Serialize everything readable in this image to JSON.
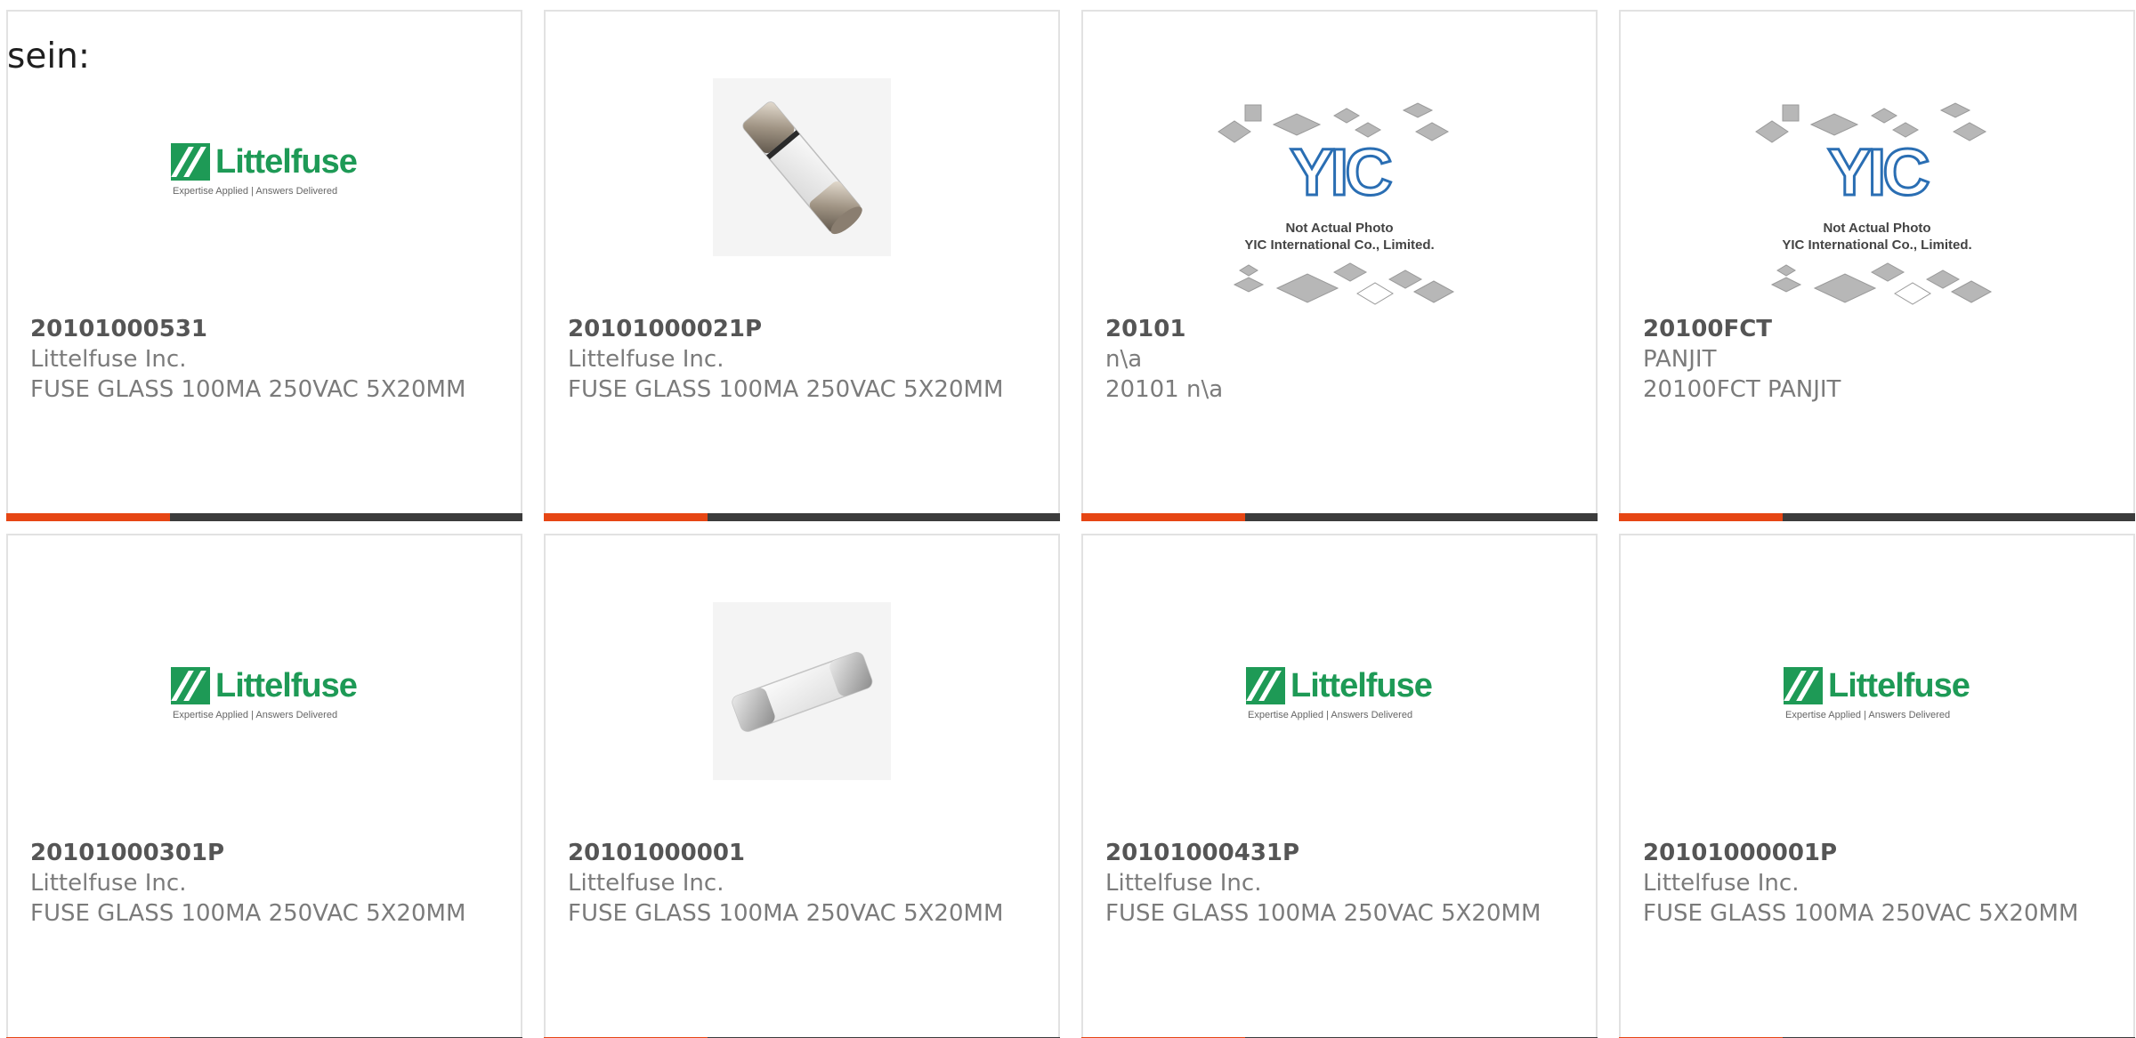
{
  "page": {
    "top_label": "sein:"
  },
  "products": [
    {
      "part_number": "20101000531",
      "manufacturer": "Littelfuse Inc.",
      "description": "FUSE GLASS 100MA 250VAC 5X20MM",
      "image": "littelfuse-logo"
    },
    {
      "part_number": "20101000021P",
      "manufacturer": "Littelfuse Inc.",
      "description": "FUSE GLASS 100MA 250VAC 5X20MM",
      "image": "fuse-photo-metal-caps"
    },
    {
      "part_number": "20101",
      "manufacturer": "n\\a",
      "description": "20101 n\\a",
      "image": "yic-placeholder"
    },
    {
      "part_number": "20100FCT",
      "manufacturer": "PANJIT",
      "description": "20100FCT PANJIT",
      "image": "yic-placeholder"
    },
    {
      "part_number": "20101000301P",
      "manufacturer": "Littelfuse Inc.",
      "description": "FUSE GLASS 100MA 250VAC 5X20MM",
      "image": "littelfuse-logo"
    },
    {
      "part_number": "20101000001",
      "manufacturer": "Littelfuse Inc.",
      "description": "FUSE GLASS 100MA 250VAC 5X20MM",
      "image": "fuse-photo-silver-caps"
    },
    {
      "part_number": "20101000431P",
      "manufacturer": "Littelfuse Inc.",
      "description": "FUSE GLASS 100MA 250VAC 5X20MM",
      "image": "littelfuse-logo"
    },
    {
      "part_number": "20101000001P",
      "manufacturer": "Littelfuse Inc.",
      "description": "FUSE GLASS 100MA 250VAC 5X20MM",
      "image": "littelfuse-logo"
    }
  ],
  "logo": {
    "littelfuse_word": "Littelfuse",
    "littelfuse_tagline": "Expertise Applied | Answers Delivered",
    "yic_word": "YIC",
    "yic_line1": "Not Actual Photo",
    "yic_line2": "YIC International Co., Limited."
  },
  "colors": {
    "accent_bar": "#e64614",
    "dark_bar": "#3c3c3c",
    "littelfuse_green": "#1e9a56",
    "yic_blue": "#2a6eb3"
  }
}
